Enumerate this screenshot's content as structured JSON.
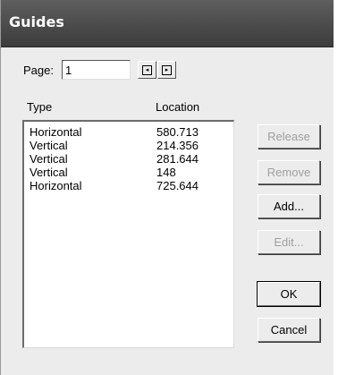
{
  "window": {
    "title": "Guides"
  },
  "page": {
    "label": "Page:",
    "value": "1"
  },
  "nav": {
    "prev_icon": "page-back-icon",
    "next_icon": "page-forward-icon",
    "prev_glyph": "◂",
    "next_glyph": "▸"
  },
  "list": {
    "headers": {
      "type": "Type",
      "location": "Location"
    },
    "rows": [
      {
        "type": "Horizontal",
        "location": "580.713"
      },
      {
        "type": "Vertical",
        "location": "214.356"
      },
      {
        "type": "Vertical",
        "location": "281.644"
      },
      {
        "type": "Vertical",
        "location": "148"
      },
      {
        "type": "Horizontal",
        "location": "725.644"
      }
    ]
  },
  "buttons": {
    "release": "Release",
    "remove": "Remove",
    "add": "Add...",
    "edit": "Edit...",
    "ok": "OK",
    "cancel": "Cancel"
  }
}
